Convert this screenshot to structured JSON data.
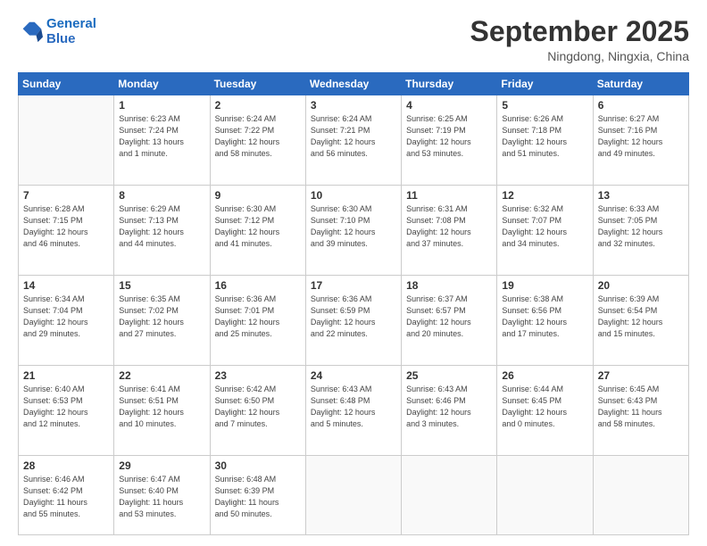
{
  "logo": {
    "line1": "General",
    "line2": "Blue"
  },
  "header": {
    "month": "September 2025",
    "location": "Ningdong, Ningxia, China"
  },
  "weekdays": [
    "Sunday",
    "Monday",
    "Tuesday",
    "Wednesday",
    "Thursday",
    "Friday",
    "Saturday"
  ],
  "weeks": [
    [
      {
        "day": "",
        "info": ""
      },
      {
        "day": "1",
        "info": "Sunrise: 6:23 AM\nSunset: 7:24 PM\nDaylight: 13 hours\nand 1 minute."
      },
      {
        "day": "2",
        "info": "Sunrise: 6:24 AM\nSunset: 7:22 PM\nDaylight: 12 hours\nand 58 minutes."
      },
      {
        "day": "3",
        "info": "Sunrise: 6:24 AM\nSunset: 7:21 PM\nDaylight: 12 hours\nand 56 minutes."
      },
      {
        "day": "4",
        "info": "Sunrise: 6:25 AM\nSunset: 7:19 PM\nDaylight: 12 hours\nand 53 minutes."
      },
      {
        "day": "5",
        "info": "Sunrise: 6:26 AM\nSunset: 7:18 PM\nDaylight: 12 hours\nand 51 minutes."
      },
      {
        "day": "6",
        "info": "Sunrise: 6:27 AM\nSunset: 7:16 PM\nDaylight: 12 hours\nand 49 minutes."
      }
    ],
    [
      {
        "day": "7",
        "info": "Sunrise: 6:28 AM\nSunset: 7:15 PM\nDaylight: 12 hours\nand 46 minutes."
      },
      {
        "day": "8",
        "info": "Sunrise: 6:29 AM\nSunset: 7:13 PM\nDaylight: 12 hours\nand 44 minutes."
      },
      {
        "day": "9",
        "info": "Sunrise: 6:30 AM\nSunset: 7:12 PM\nDaylight: 12 hours\nand 41 minutes."
      },
      {
        "day": "10",
        "info": "Sunrise: 6:30 AM\nSunset: 7:10 PM\nDaylight: 12 hours\nand 39 minutes."
      },
      {
        "day": "11",
        "info": "Sunrise: 6:31 AM\nSunset: 7:08 PM\nDaylight: 12 hours\nand 37 minutes."
      },
      {
        "day": "12",
        "info": "Sunrise: 6:32 AM\nSunset: 7:07 PM\nDaylight: 12 hours\nand 34 minutes."
      },
      {
        "day": "13",
        "info": "Sunrise: 6:33 AM\nSunset: 7:05 PM\nDaylight: 12 hours\nand 32 minutes."
      }
    ],
    [
      {
        "day": "14",
        "info": "Sunrise: 6:34 AM\nSunset: 7:04 PM\nDaylight: 12 hours\nand 29 minutes."
      },
      {
        "day": "15",
        "info": "Sunrise: 6:35 AM\nSunset: 7:02 PM\nDaylight: 12 hours\nand 27 minutes."
      },
      {
        "day": "16",
        "info": "Sunrise: 6:36 AM\nSunset: 7:01 PM\nDaylight: 12 hours\nand 25 minutes."
      },
      {
        "day": "17",
        "info": "Sunrise: 6:36 AM\nSunset: 6:59 PM\nDaylight: 12 hours\nand 22 minutes."
      },
      {
        "day": "18",
        "info": "Sunrise: 6:37 AM\nSunset: 6:57 PM\nDaylight: 12 hours\nand 20 minutes."
      },
      {
        "day": "19",
        "info": "Sunrise: 6:38 AM\nSunset: 6:56 PM\nDaylight: 12 hours\nand 17 minutes."
      },
      {
        "day": "20",
        "info": "Sunrise: 6:39 AM\nSunset: 6:54 PM\nDaylight: 12 hours\nand 15 minutes."
      }
    ],
    [
      {
        "day": "21",
        "info": "Sunrise: 6:40 AM\nSunset: 6:53 PM\nDaylight: 12 hours\nand 12 minutes."
      },
      {
        "day": "22",
        "info": "Sunrise: 6:41 AM\nSunset: 6:51 PM\nDaylight: 12 hours\nand 10 minutes."
      },
      {
        "day": "23",
        "info": "Sunrise: 6:42 AM\nSunset: 6:50 PM\nDaylight: 12 hours\nand 7 minutes."
      },
      {
        "day": "24",
        "info": "Sunrise: 6:43 AM\nSunset: 6:48 PM\nDaylight: 12 hours\nand 5 minutes."
      },
      {
        "day": "25",
        "info": "Sunrise: 6:43 AM\nSunset: 6:46 PM\nDaylight: 12 hours\nand 3 minutes."
      },
      {
        "day": "26",
        "info": "Sunrise: 6:44 AM\nSunset: 6:45 PM\nDaylight: 12 hours\nand 0 minutes."
      },
      {
        "day": "27",
        "info": "Sunrise: 6:45 AM\nSunset: 6:43 PM\nDaylight: 11 hours\nand 58 minutes."
      }
    ],
    [
      {
        "day": "28",
        "info": "Sunrise: 6:46 AM\nSunset: 6:42 PM\nDaylight: 11 hours\nand 55 minutes."
      },
      {
        "day": "29",
        "info": "Sunrise: 6:47 AM\nSunset: 6:40 PM\nDaylight: 11 hours\nand 53 minutes."
      },
      {
        "day": "30",
        "info": "Sunrise: 6:48 AM\nSunset: 6:39 PM\nDaylight: 11 hours\nand 50 minutes."
      },
      {
        "day": "",
        "info": ""
      },
      {
        "day": "",
        "info": ""
      },
      {
        "day": "",
        "info": ""
      },
      {
        "day": "",
        "info": ""
      }
    ]
  ]
}
